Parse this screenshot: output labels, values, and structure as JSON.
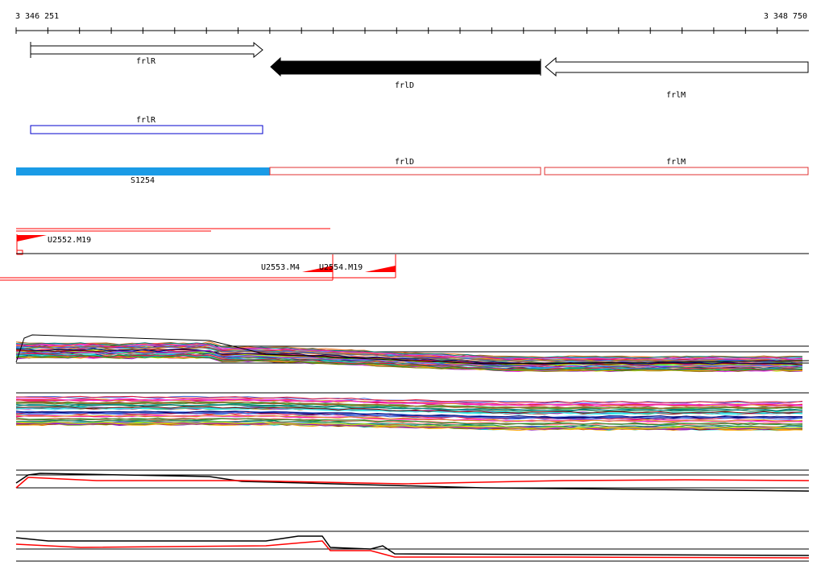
{
  "ruler": {
    "start_label": "3 346 251",
    "end_label": "3 348 750"
  },
  "genes": [
    {
      "id": "gene-frlR",
      "label": "frlR",
      "strand": "+",
      "color": "#ffffff"
    },
    {
      "id": "gene-frlD",
      "label": "frlD",
      "strand": "-",
      "color": "#000000"
    },
    {
      "id": "gene-frlM",
      "label": "frlM",
      "strand": "-",
      "color": "#ffffff"
    }
  ],
  "transcripts": [
    {
      "id": "transcript-frlR",
      "label": "frlR",
      "color": "#0000cc"
    }
  ],
  "segments": [
    {
      "id": "segment-S1254",
      "label": "S1254",
      "color": "#1a9be6"
    },
    {
      "id": "segment-frlD",
      "label": "frlD",
      "color": "#e03030"
    },
    {
      "id": "segment-frlM",
      "label": "frlM",
      "color": "#e03030"
    }
  ],
  "features": [
    {
      "id": "feature-U2552",
      "label": "U2552.M19",
      "color": "#ff0000"
    },
    {
      "id": "feature-U2553",
      "label": "U2553.M4",
      "color": "#ff0000"
    },
    {
      "id": "feature-U2554",
      "label": "U2554.M19",
      "color": "#ff0000"
    }
  ],
  "colors": {
    "axis": "#000000",
    "accent_red": "#ff0000",
    "segment_blue": "#1a9be6",
    "transcript_blue": "#0000cc"
  }
}
